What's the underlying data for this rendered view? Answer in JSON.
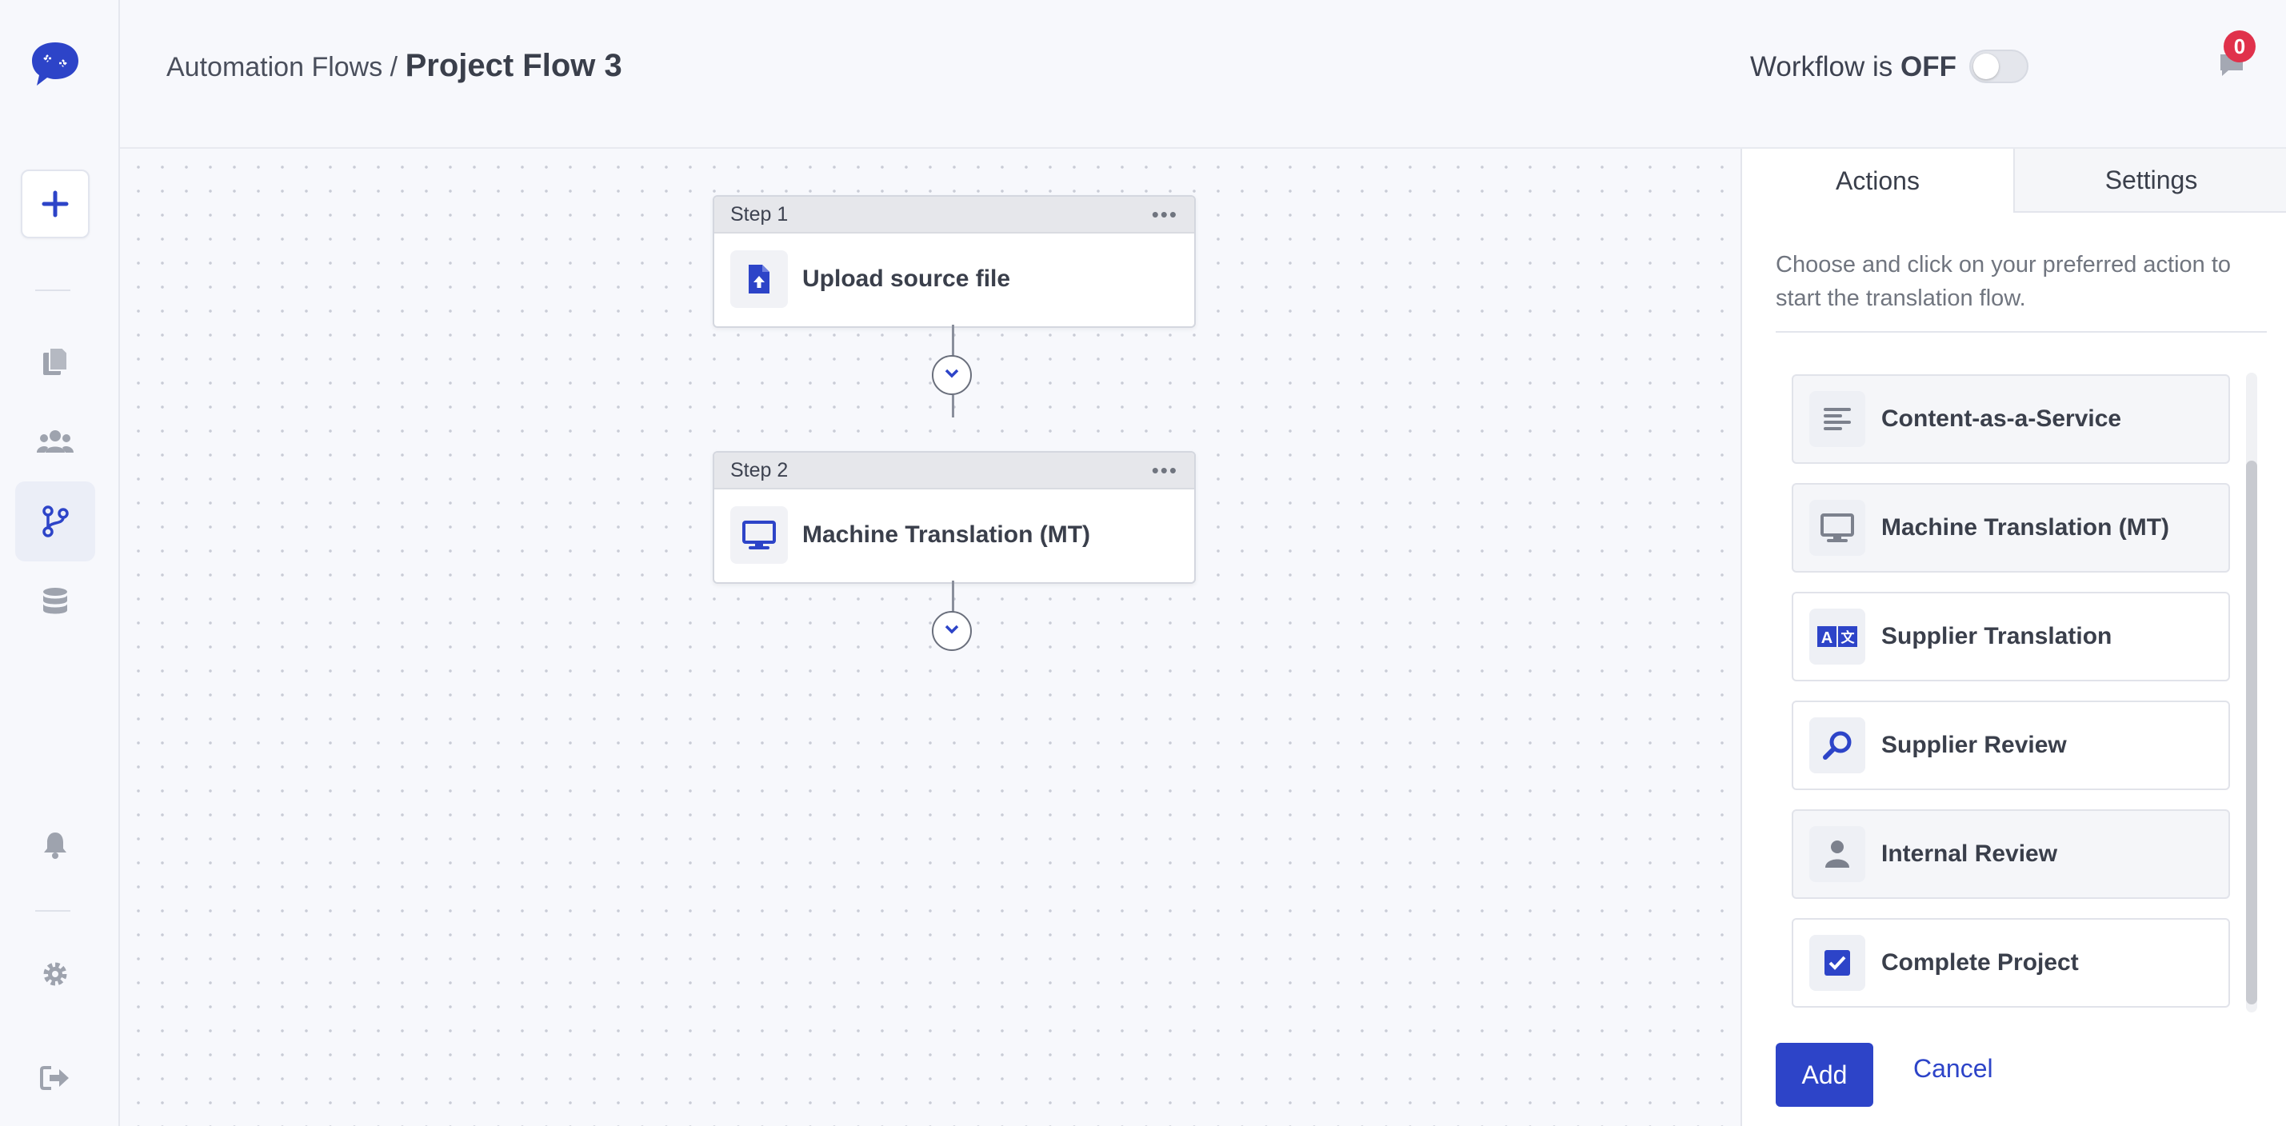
{
  "header": {
    "breadcrumb_parent": "Automation Flows /",
    "breadcrumb_current": "Project Flow 3",
    "workflow_prefix": "Workflow is",
    "workflow_state": "OFF",
    "notification_count": "0"
  },
  "sidebar": {
    "items": [
      {
        "icon": "logo-chat-icon"
      },
      {
        "icon": "plus-icon"
      },
      {
        "icon": "documents-icon"
      },
      {
        "icon": "users-icon"
      },
      {
        "icon": "workflow-branch-icon",
        "active": true
      },
      {
        "icon": "database-icon"
      },
      {
        "icon": "bell-icon"
      },
      {
        "icon": "gear-icon"
      },
      {
        "icon": "logout-icon"
      }
    ]
  },
  "flow": {
    "steps": [
      {
        "label": "Step 1",
        "title": "Upload source file",
        "icon": "upload-file-icon"
      },
      {
        "label": "Step 2",
        "title": "Machine Translation (MT)",
        "icon": "monitor-icon"
      }
    ],
    "menu_glyph": "•••"
  },
  "panel": {
    "tabs": [
      "Actions",
      "Settings"
    ],
    "active_tab": "Actions",
    "description": "Choose and click on your preferred action to start the translation flow.",
    "actions": [
      {
        "label": "Content-as-a-Service",
        "icon": "text-lines-icon"
      },
      {
        "label": "Machine Translation (MT)",
        "icon": "monitor-icon"
      },
      {
        "label": "Supplier Translation",
        "icon": "translate-icon"
      },
      {
        "label": "Supplier Review",
        "icon": "magnifier-icon"
      },
      {
        "label": "Internal Review",
        "icon": "person-icon"
      },
      {
        "label": "Complete Project",
        "icon": "checkbox-icon"
      }
    ],
    "add_label": "Add",
    "cancel_label": "Cancel"
  },
  "colors": {
    "accent": "#2d44c8",
    "badge": "#e0314b",
    "muted_icon": "#9ea3ae"
  }
}
